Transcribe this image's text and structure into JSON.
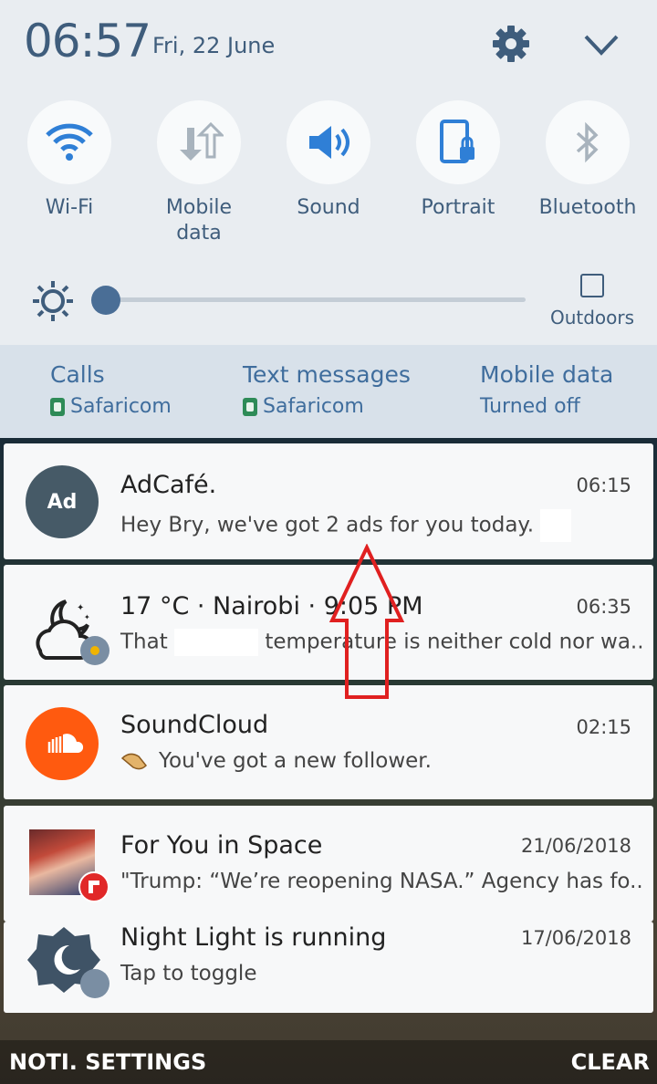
{
  "status": {
    "time": "06:57",
    "date": "Fri, 22 June"
  },
  "quick_toggles": [
    {
      "label": "Wi-Fi",
      "icon": "wifi-icon"
    },
    {
      "label": "Mobile\ndata",
      "icon": "mobile-data-icon"
    },
    {
      "label": "Sound",
      "icon": "sound-icon"
    },
    {
      "label": "Portrait",
      "icon": "portrait-lock-icon"
    },
    {
      "label": "Bluetooth",
      "icon": "bluetooth-icon"
    }
  ],
  "brightness": {
    "level": 0.0,
    "outdoors_label": "Outdoors"
  },
  "sims": [
    {
      "title": "Calls",
      "value": "Safaricom"
    },
    {
      "title": "Text messages",
      "value": "Safaricom"
    },
    {
      "title": "Mobile data",
      "value": "Turned off"
    }
  ],
  "notifications": [
    {
      "app": "adcafe",
      "avatar": "Ad",
      "title": "AdCafé.",
      "body": "Hey Bry, we've got 2 ads for you today.",
      "time": "06:15"
    },
    {
      "app": "weather",
      "title": "17 °C · Nairobi · 9:05 PM",
      "body_prefix": "That",
      "body_suffix": "temperature is neither cold nor wa..",
      "time": "06:35"
    },
    {
      "app": "soundcloud",
      "title": "SoundCloud",
      "body": "You've got a new follower.",
      "time": "02:15"
    },
    {
      "app": "flipboard",
      "title": "For You in Space",
      "body": "\"Trump: “We’re reopening NASA.” Agency has fo..",
      "time": "21/06/2018"
    },
    {
      "app": "night-light",
      "title": "Night Light is running",
      "body": "Tap to toggle",
      "time": "17/06/2018"
    }
  ],
  "bottom": {
    "settings_label": "NOTI. SETTINGS",
    "clear_label": "CLEAR"
  },
  "colors": {
    "panel_bg": "#e9edf1",
    "accent_text": "#3f5d7c",
    "icon_blue": "#2f7fd6",
    "soundcloud": "#ff5a0f",
    "annotation_red": "#e02020"
  }
}
